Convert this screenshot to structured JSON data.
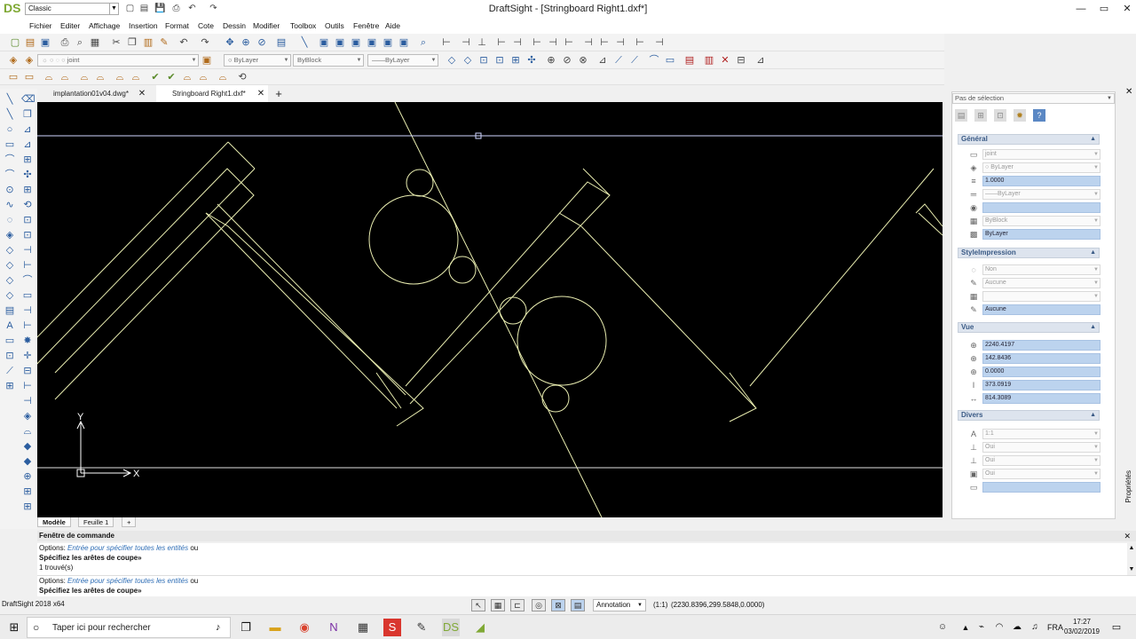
{
  "app": {
    "logo": "DS",
    "workspace": "Classic",
    "title": "DraftSight - [Stringboard Right1.dxf*]",
    "controls": {
      "minimize": "—",
      "maximize": "▭",
      "close": "✕"
    }
  },
  "menu": [
    "Fichier",
    "Editer",
    "Affichage",
    "Insertion",
    "Format",
    "Cote",
    "Dessin",
    "Modifier",
    "Toolbox",
    "Outils",
    "Fenêtre",
    "Aide"
  ],
  "layer_bar": {
    "layer": "joint",
    "color": "ByLayer",
    "linetype": "ByBlock",
    "lineweight": "——ByLayer"
  },
  "doc_tabs": [
    {
      "label": "implantation01v04.dwg*",
      "close": "✕"
    },
    {
      "label": "Stringboard Right1.dxf*",
      "close": "✕"
    }
  ],
  "new_tab": "+",
  "canvas": {
    "ucs_y": "Y",
    "ucs_x": "X",
    "colors": {
      "background": "#000000",
      "geometry": "#e9edb0",
      "axis": "#cfd6ff"
    }
  },
  "layout_tabs": {
    "model": "Modèle",
    "sheet": "Feuille 1",
    "add": "+"
  },
  "command": {
    "header": "Fenêtre de commande",
    "close": "✕",
    "history": [
      {
        "prefix": "Options: ",
        "option": "Entrée pour spécifier toutes les entités",
        "suffix": " ou"
      },
      {
        "prompt": "Spécifiez les arêtes de coupe»"
      },
      {
        "result": "1 trouvé(s)"
      }
    ],
    "current": [
      {
        "prefix": "Options: ",
        "option": "Entrée pour spécifier toutes les entités",
        "suffix": " ou"
      },
      {
        "prompt": "Spécifiez les arêtes de coupe»"
      }
    ]
  },
  "status": {
    "app_version": "DraftSight 2018 x64",
    "annotation": "Annotation",
    "scale": "(1:1)",
    "coords": "(2230.8396,299.5848,0.0000)"
  },
  "properties": {
    "selection": "Pas de sélection",
    "side_label": "Propriétés",
    "general": {
      "title": "Général",
      "layer": "joint",
      "color": "ByLayer",
      "linetype_scale": "1.0000",
      "linetype": "——ByLayer",
      "lineweight": "",
      "transparency": "ByBlock",
      "lineweight2": "ByLayer"
    },
    "print_style": {
      "title": "StyleImpression",
      "style": "Non",
      "table": "Aucune",
      "attached": "",
      "table_type": "Aucune"
    },
    "view": {
      "title": "Vue",
      "center_x": "2240.4197",
      "center_y": "142.8436",
      "center_z": "0.0000",
      "height": "373.0919",
      "width": "814.3089"
    },
    "misc": {
      "title": "Divers",
      "annotation_scale": "1:1",
      "ucs_icon_on": "Oui",
      "ucs_icon_origin": "Oui",
      "ucs_per_viewport": "Oui",
      "ucs_name": ""
    }
  },
  "taskbar": {
    "search_placeholder": "Taper ici pour rechercher",
    "lang": "FRA",
    "time": "17:27",
    "date": "03/02/2019"
  }
}
